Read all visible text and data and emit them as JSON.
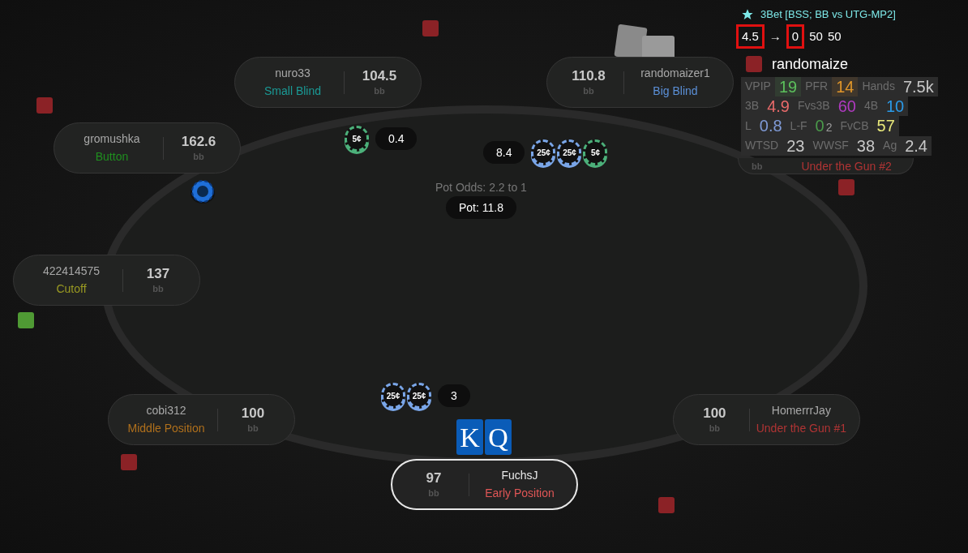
{
  "table": {
    "pot_odds": "Pot Odds: 2.2 to 1",
    "pot": "Pot: 11.8"
  },
  "seats": [
    {
      "name": "nuro33",
      "position": "Small Blind",
      "color": "#1a9a96",
      "stack": "104.5",
      "unit": "bb",
      "kind": "stack-right",
      "hero": false,
      "marker": {
        "color": "#8b2226"
      }
    },
    {
      "name": "randomaizer1",
      "position": "Big Blind",
      "color": "#5b90d8",
      "stack": "110.8",
      "unit": "bb",
      "kind": "stack-left",
      "hero": false
    },
    {
      "name": "gromushka",
      "position": "Button",
      "color": "#1f8f1f",
      "stack": "162.6",
      "unit": "bb",
      "kind": "stack-right",
      "hero": false,
      "marker": {
        "color": "#8b2226"
      }
    },
    {
      "name": "422414575",
      "position": "Cutoff",
      "color": "#9a9a22",
      "stack": "137",
      "unit": "bb",
      "kind": "stack-right",
      "hero": false,
      "marker": {
        "color": "#4f9a34"
      }
    },
    {
      "name": "cobi312",
      "position": "Middle Position",
      "color": "#b0701c",
      "stack": "100",
      "unit": "bb",
      "kind": "stack-right",
      "hero": false,
      "marker": {
        "color": "#8b2226"
      }
    },
    {
      "name": "FuchsJ",
      "position": "Early Position",
      "color": "#e05656",
      "stack": "97",
      "unit": "bb",
      "kind": "stack-left",
      "hero": true,
      "marker": {
        "color": "#8b2226"
      }
    },
    {
      "name": "HomerrrJay",
      "position": "Under the Gun #1",
      "color": "#b03434",
      "stack": "100",
      "unit": "bb",
      "kind": "stack-left",
      "hero": false
    },
    {
      "position": "Under the Gun #2",
      "color": "#b03434",
      "unit": "bb",
      "kind": "partial",
      "hero": false,
      "marker": {
        "color": "#8b2226"
      }
    }
  ],
  "bets": [
    {
      "amount": "0.4",
      "chips": [
        {
          "label": "5¢",
          "color": "#4cb07a"
        }
      ],
      "kind": "chips-left"
    },
    {
      "amount": "8.4",
      "chips": [
        {
          "label": "25¢",
          "color": "#7aa6e8"
        },
        {
          "label": "25¢",
          "color": "#7aa6e8"
        },
        {
          "label": "5¢",
          "color": "#4cb07a"
        }
      ],
      "kind": "chips-right"
    },
    {
      "amount": "3",
      "chips": [
        {
          "label": "25¢",
          "color": "#7aa6e8"
        },
        {
          "label": "25¢",
          "color": "#7aa6e8"
        }
      ],
      "kind": "chips-left"
    }
  ],
  "hero_cards": [
    "K",
    "Q"
  ],
  "hud": {
    "title": "3Bet [BSS; BB vs UTG-MP2]",
    "line": [
      {
        "text": "4.5",
        "boxed": true
      },
      {
        "text": "→",
        "boxed": false
      },
      {
        "text": "0",
        "boxed": true
      },
      {
        "text": "50",
        "boxed": false
      },
      {
        "text": "50",
        "boxed": false
      }
    ],
    "player": "randomaize",
    "marker": {
      "color": "#8b2226"
    },
    "rows": [
      [
        {
          "label": "VPIP",
          "value": "19",
          "color": "#5cc05c",
          "highlight": true
        },
        {
          "label": "PFR",
          "value": "14",
          "color": "#e0962a",
          "highlight": true
        },
        {
          "label": "Hands",
          "value": "7.5k",
          "color": "#c8c8c8",
          "highlight": false
        }
      ],
      [
        {
          "label": "3B",
          "value": "4.9",
          "color": "#e86a6a",
          "highlight": false
        },
        {
          "label": "Fvs3B",
          "value": "60",
          "color": "#b03ac0",
          "highlight": false
        },
        {
          "label": "4B",
          "value": "10",
          "color": "#2a9ae8",
          "highlight": false
        }
      ],
      [
        {
          "label": "L",
          "value": "0.8",
          "color": "#7f9ad6",
          "highlight": false
        },
        {
          "label": "L-F",
          "value": "0",
          "color": "#4a9a4a",
          "extra": "2",
          "highlight": false
        },
        {
          "label": "FvCB",
          "value": "57",
          "color": "#e8e87a",
          "highlight": false
        }
      ],
      [
        {
          "label": "WTSD",
          "value": "23",
          "color": "#c8c8c8",
          "highlight": false
        },
        {
          "label": "WWSF",
          "value": "38",
          "color": "#c8c8c8",
          "highlight": false
        },
        {
          "label": "Ag",
          "value": "2.4",
          "color": "#c8c8c8",
          "highlight": false
        }
      ]
    ]
  }
}
